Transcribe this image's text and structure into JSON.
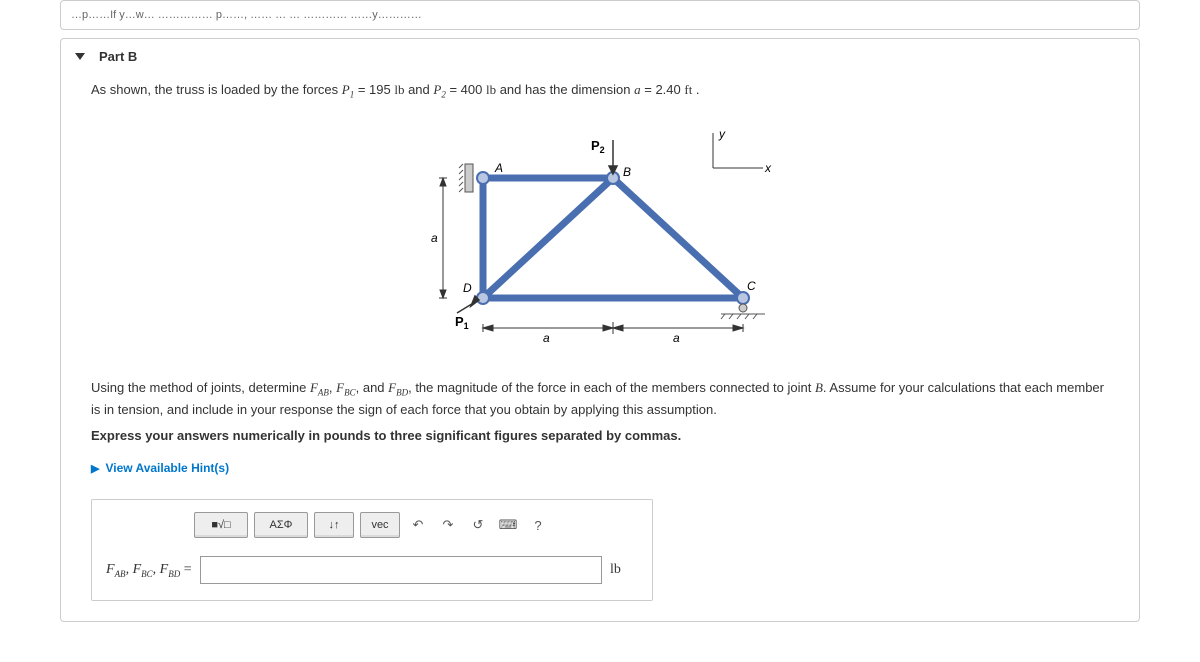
{
  "top_fragment": "…p……If y…w… …………… p……, …… … … ………… ……y…………",
  "part": {
    "label": "Part B",
    "intro_prefix": "As shown, the truss is loaded by the forces ",
    "p1_sym": "P",
    "p1_sub": "1",
    "p1_val": " = 195 ",
    "p1_unit": "lb",
    "and1": " and ",
    "p2_sym": "P",
    "p2_sub": "2",
    "p2_val": " = 400 ",
    "p2_unit": "lb",
    "dim_txt": " and has the dimension ",
    "a_sym": "a",
    "a_val": " = 2.40 ",
    "a_unit": "ft",
    "period": " .",
    "instr_a": "Using the method of joints, determine ",
    "fab": "F",
    "fab_sub": "AB",
    "comma": ", ",
    "fbc": "F",
    "fbc_sub": "BC",
    "and2": ", and ",
    "fbd": "F",
    "fbd_sub": "BD",
    "instr_b": ", the magnitude of the force in each of the members connected to joint ",
    "joint": "B",
    "instr_c": ". Assume for your calculations that each member is in tension, and include in your response the sign of each force that you obtain by applying this assumption.",
    "instr_bold": "Express your answers numerically in pounds to three significant figures separated by commas.",
    "hints": "View Available Hint(s)"
  },
  "figure": {
    "A": "A",
    "B": "B",
    "C": "C",
    "D": "D",
    "P1": "P",
    "P1s": "1",
    "P2": "P",
    "P2s": "2",
    "a": "a",
    "x": "x",
    "y": "y"
  },
  "toolbar": {
    "template": "■√□",
    "greek": "ΑΣΦ",
    "arrows": "↓↑",
    "vec": "vec",
    "undo": "↶",
    "redo": "↷",
    "reset": "↺",
    "keyboard": "⌨",
    "help": "?"
  },
  "answer": {
    "label": "F",
    "s1": "AB",
    "s2": "BC",
    "s3": "BD",
    "eq": " = ",
    "unit": "lb"
  }
}
